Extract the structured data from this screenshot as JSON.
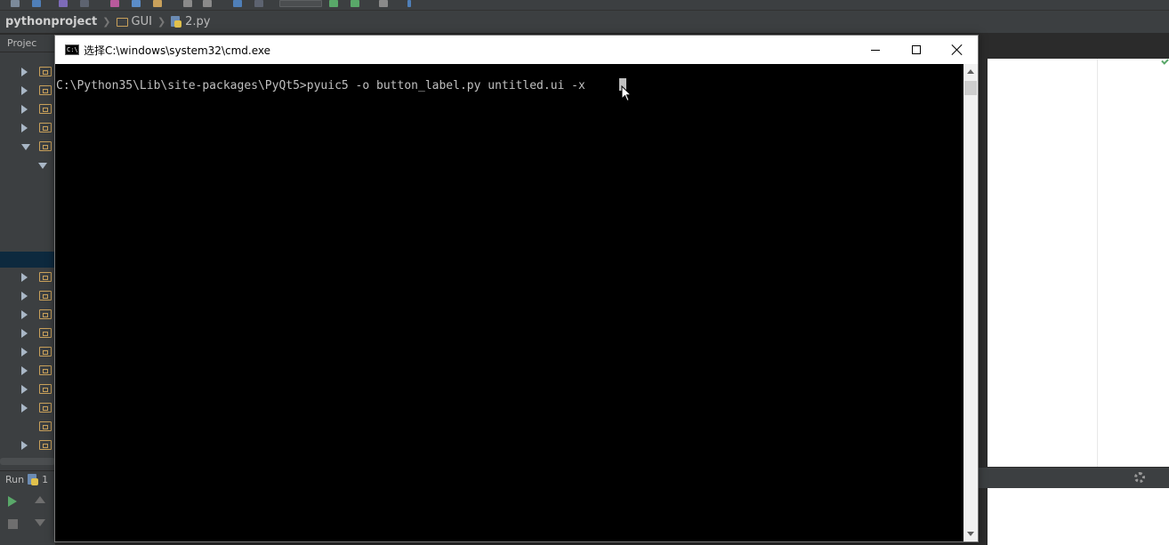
{
  "ide": {
    "breadcrumb": {
      "project": "pythonproject",
      "folder": "GUI",
      "file": "2.py"
    },
    "project_tab": "Projec",
    "run_panel": {
      "label": "Run",
      "tab_suffix": "1"
    }
  },
  "cmd": {
    "title": "选择C:\\windows\\system32\\cmd.exe",
    "console_line": "C:\\Python35\\Lib\\site-packages\\PyQt5>pyuic5 -o button_label.py untitled.ui -x",
    "colors": {
      "background": "#000000",
      "text": "#c0c0c0",
      "titlebar": "#ffffff"
    }
  }
}
